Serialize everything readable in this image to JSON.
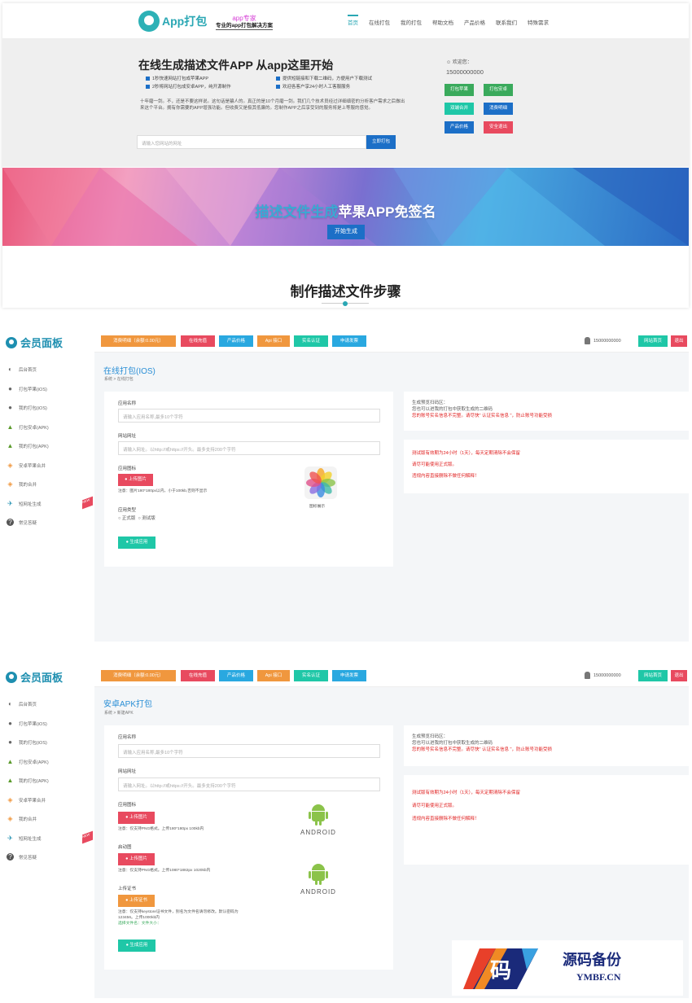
{
  "site": {
    "logo_text": "App打包",
    "slogan_top": "app专家",
    "slogan_bottom": "专业的app打包解决方案",
    "menu": [
      "首页",
      "在线打包",
      "我的打包",
      "帮助文档",
      "产品价格",
      "联系我们",
      "特殊需求"
    ],
    "hero_title": "在线生成描述文件APP 从app这里开始",
    "features": [
      "1秒快速网站打包成苹果APP",
      "提供短链接和下载二维码，方便用户下载测试",
      "2秒将网站打包成安卓APP，纯开源制作",
      "欢迎各客户享24小时人工客服服务"
    ],
    "desc": "十年磨一剑。不，还是不要这样说。这句话是骗人的。真正的是10个月磨一剑。我们几个技术员经过详细缜密的分析客户需求之后做出来这个平台。拥有你需要的APP增强功能。但收费又是极其低廉的。您制作APP之后享受到的服务将是上等服的感觉。",
    "search_placeholder": "请输入您网站的网址",
    "search_button": "立即打包",
    "welcome_label": "欢迎您：",
    "welcome_user": "15000000000",
    "quick_buttons": [
      {
        "label": "打包苹果",
        "color": "#3aaa5c"
      },
      {
        "label": "打包安卓",
        "color": "#3aaa5c"
      },
      {
        "label": "双端合并",
        "color": "#1fc7a7"
      },
      {
        "label": "消费明细",
        "color": "#1c6fc7"
      },
      {
        "label": "产品价格",
        "color": "#1c6fc7"
      },
      {
        "label": "安全退出",
        "color": "#e84a5f"
      }
    ],
    "banner_title_highlight": "描述文件生成",
    "banner_title_rest": "苹果APP免签名",
    "banner_button": "开始生成",
    "steps_title": "制作描述文件步骤"
  },
  "panel": {
    "logo_text": "会员面板",
    "sidebar": [
      {
        "label": "后台首页",
        "icon": "dashboard-icon",
        "glyph": "◐"
      },
      {
        "label": "打包苹果(iOS)",
        "icon": "apple-icon",
        "glyph": "●"
      },
      {
        "label": "我的打包(iOS)",
        "icon": "apple-icon",
        "glyph": "●"
      },
      {
        "label": "打包安卓(APK)",
        "icon": "android-icon",
        "glyph": "▲"
      },
      {
        "label": "我的打包(APK)",
        "icon": "android-icon",
        "glyph": "▲"
      },
      {
        "label": "安卓苹果合并",
        "icon": "merge-icon",
        "glyph": "◈"
      },
      {
        "label": "我的合并",
        "icon": "merge-icon",
        "glyph": "◈"
      },
      {
        "label": "短网址生成",
        "icon": "plane-icon",
        "glyph": "✈"
      },
      {
        "label": "常见答疑",
        "icon": "question-icon",
        "glyph": "?"
      }
    ],
    "new_badge": "NEW",
    "topbar": [
      {
        "label": "消费明细（余额:0.00元）",
        "color": "#f0973e"
      },
      {
        "label": "在线充值",
        "color": "#e84a5f"
      },
      {
        "label": "产品价格",
        "color": "#29a8e0"
      },
      {
        "label": "Api 接口",
        "color": "#f0973e"
      },
      {
        "label": "实名认证",
        "color": "#1fc7a7"
      },
      {
        "label": "申请发票",
        "color": "#29a8e0"
      }
    ],
    "user": "15000000000",
    "home_button": "网站首页",
    "logout_button": "退出"
  },
  "ios": {
    "title": "在线打包(IOS)",
    "crumb": "系统 > 在线打包",
    "app_name_label": "应用名称",
    "app_name_placeholder": "请输入应用名称,最多10个字符",
    "url_label": "网站网址",
    "url_placeholder": "请输入网址。以http://或https://开头。最多支持200个字符",
    "icon_label": "应用图标",
    "upload_label": "上传图片",
    "icon_note": "注意：图片180*180px以内，小于100kb,否则不显示",
    "icon_preview": "图标展示",
    "type_label": "应用类型",
    "type_options": [
      "正式版",
      "测试版"
    ],
    "generate": "生成应用",
    "info1_line1": "生成预览扫码区：",
    "info1_line2": "您也可以进我的打包中获取生成的二维码",
    "info1_line3": "您的账号实名信息不完整。请尽快\" 认证实名信息 \"，防止账号功能受损",
    "info2": [
      "测试版有效期为24小时（1天），每天定期清除不会保留",
      "请尽可能使用正式版。",
      "违规内容直接删除不做任何解释！"
    ]
  },
  "apk": {
    "title": "安卓APK打包",
    "crumb": "系统 > 新建APK",
    "app_name_label": "应用名称",
    "app_name_placeholder": "请输入应用名称,最多10个字符",
    "url_label": "网站网址",
    "url_placeholder": "请输入网址。以http://或https://开头。最多支持200个字符",
    "icon_label": "应用图标",
    "upload_label": "上传图片",
    "icon_note": "注意：仅支持PNG格式。上传180*180px 100kb内",
    "splash_label": "启动图",
    "splash_note": "注意：仅支持PNG格式。上传1080*1882px 1020kb内",
    "cert_label": "上传证书",
    "cert_button": "上传证书",
    "cert_note": "注意：仅支持keystore证书文件，别名为文件名请勿修改。默认密码为123456。上传1000kb内",
    "cert_selected": "选择文件名：文件大小：",
    "android_text": "ANDROID",
    "generate": "生成应用",
    "info1_line1": "生成预览扫码区：",
    "info1_line2": "您也可以进我的打包中获取生成的二维码",
    "info1_line3": "您的账号实名信息不完整。请尽快\" 认证实名信息 \"，防止账号功能受损",
    "info2": [
      "测试版有效期为24小时（1天），每天定期清除不会保留",
      "请尽可能使用正式版。",
      "违规内容直接删除不做任何解释！"
    ]
  },
  "watermark": {
    "char": "码",
    "title": "源码备份",
    "domain": "YMBF.CN"
  }
}
